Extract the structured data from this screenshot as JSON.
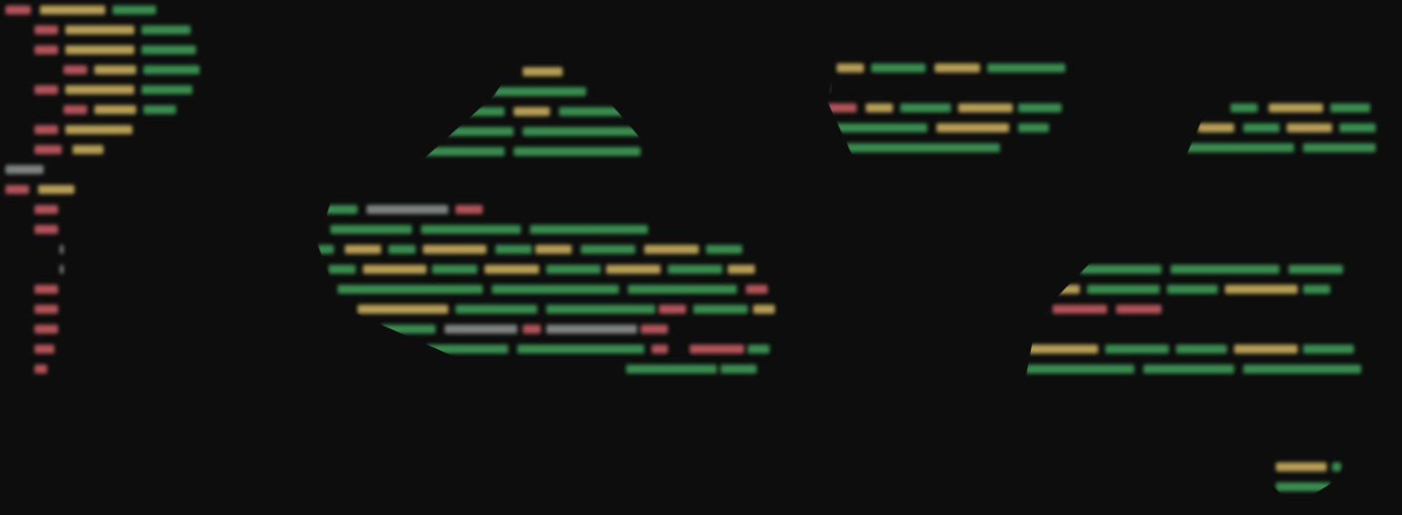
{
  "colors": {
    "background": "#0d0d0d",
    "tag": "#c25b61",
    "attribute": "#c9ae5e",
    "string": "#3f9a58",
    "plain": "#8a8f8c"
  },
  "fragments": [
    {
      "name": "code-fragment-left",
      "lines": [
        [
          [
            "tag",
            6,
            28
          ],
          [
            "attribute",
            44,
            72
          ],
          [
            "string",
            124,
            48
          ]
        ],
        [
          [
            "tag",
            38,
            26
          ],
          [
            "attribute",
            72,
            76
          ],
          [
            "string",
            156,
            54
          ]
        ],
        [
          [
            "tag",
            38,
            26
          ],
          [
            "attribute",
            72,
            76
          ],
          [
            "string",
            156,
            60
          ]
        ],
        [
          [
            "tag",
            70,
            26
          ],
          [
            "attribute",
            104,
            46
          ],
          [
            "string",
            158,
            62
          ]
        ],
        [
          [
            "tag",
            38,
            26
          ],
          [
            "attribute",
            72,
            76
          ],
          [
            "string",
            156,
            56
          ]
        ],
        [
          [
            "tag",
            70,
            26
          ],
          [
            "attribute",
            104,
            46
          ],
          [
            "string",
            158,
            36
          ]
        ],
        [
          [
            "tag",
            38,
            26
          ],
          [
            "attribute",
            72,
            74
          ]
        ],
        [
          [
            "tag",
            38,
            30
          ],
          [
            "attribute",
            80,
            34
          ]
        ],
        [
          [
            "plain",
            6,
            42
          ]
        ],
        [
          [
            "tag",
            6,
            26
          ],
          [
            "attribute",
            42,
            40
          ]
        ],
        [
          [
            "tag",
            38,
            26
          ]
        ],
        [
          [
            "tag",
            38,
            26
          ]
        ],
        [
          [
            "plain",
            66,
            4
          ]
        ],
        [
          [
            "plain",
            66,
            4
          ]
        ],
        [
          [
            "tag",
            38,
            26
          ]
        ],
        [
          [
            "tag",
            38,
            26
          ]
        ],
        [
          [
            "tag",
            38,
            26
          ]
        ],
        [
          [
            "tag",
            38,
            22
          ]
        ],
        [
          [
            "tag",
            38,
            14
          ]
        ]
      ]
    },
    {
      "name": "code-fragment-top-center",
      "lines": [
        [
          [
            "attribute",
            110,
            44
          ]
        ],
        [
          [
            "string",
            70,
            110
          ]
        ],
        [
          [
            "string",
            50,
            40
          ],
          [
            "attribute",
            100,
            40
          ],
          [
            "string",
            150,
            80
          ]
        ],
        [
          [
            "string",
            20,
            80
          ],
          [
            "string",
            110,
            130
          ]
        ],
        [
          [
            "string",
            0,
            90
          ],
          [
            "string",
            100,
            140
          ]
        ]
      ]
    },
    {
      "name": "code-fragment-top-right-center",
      "lines": [
        [
          [
            "attribute",
            10,
            30
          ],
          [
            "string",
            48,
            60
          ],
          [
            "attribute",
            118,
            50
          ],
          [
            "string",
            176,
            86
          ]
        ],
        [
          [
            "plain",
            0,
            2
          ]
        ],
        [
          [
            "tag",
            0,
            32
          ],
          [
            "attribute",
            42,
            30
          ],
          [
            "string",
            80,
            56
          ],
          [
            "attribute",
            144,
            60
          ],
          [
            "string",
            210,
            48
          ]
        ],
        [
          [
            "string",
            0,
            110
          ],
          [
            "attribute",
            120,
            80
          ],
          [
            "string",
            210,
            34
          ]
        ],
        [
          [
            "string",
            20,
            170
          ]
        ]
      ]
    },
    {
      "name": "code-fragment-top-right",
      "lines": [
        [
          [
            "string",
            50,
            30
          ],
          [
            "attribute",
            92,
            60
          ],
          [
            "string",
            160,
            44
          ]
        ],
        [
          [
            "attribute",
            14,
            40
          ],
          [
            "string",
            64,
            40
          ],
          [
            "attribute",
            112,
            50
          ],
          [
            "string",
            170,
            40
          ]
        ],
        [
          [
            "string",
            0,
            120
          ],
          [
            "string",
            130,
            80
          ]
        ]
      ]
    },
    {
      "name": "code-fragment-center",
      "lines": [
        [
          [
            "string",
            4,
            40
          ],
          [
            "plain",
            54,
            90
          ],
          [
            "tag",
            152,
            30
          ]
        ],
        [
          [
            "string",
            14,
            90
          ],
          [
            "string",
            114,
            110
          ],
          [
            "string",
            234,
            130
          ]
        ],
        [
          [
            "string",
            0,
            18
          ],
          [
            "attribute",
            30,
            40
          ],
          [
            "string",
            78,
            30
          ],
          [
            "attribute",
            116,
            70
          ],
          [
            "string",
            196,
            40
          ],
          [
            "attribute",
            240,
            40
          ],
          [
            "string",
            290,
            60
          ],
          [
            "attribute",
            360,
            60
          ],
          [
            "string",
            428,
            40
          ]
        ],
        [
          [
            "string",
            12,
            30
          ],
          [
            "attribute",
            50,
            70
          ],
          [
            "string",
            126,
            50
          ],
          [
            "attribute",
            184,
            60
          ],
          [
            "string",
            252,
            60
          ],
          [
            "attribute",
            318,
            60
          ],
          [
            "string",
            386,
            60
          ],
          [
            "attribute",
            452,
            30
          ]
        ],
        [
          [
            "string",
            22,
            160
          ],
          [
            "string",
            192,
            140
          ],
          [
            "string",
            342,
            120
          ],
          [
            "tag",
            472,
            24
          ]
        ],
        [
          [
            "attribute",
            44,
            100
          ],
          [
            "string",
            152,
            90
          ],
          [
            "string",
            252,
            120
          ],
          [
            "tag",
            376,
            30
          ],
          [
            "string",
            414,
            60
          ],
          [
            "attribute",
            480,
            24
          ]
        ],
        [
          [
            "string",
            70,
            60
          ],
          [
            "plain",
            140,
            80
          ],
          [
            "tag",
            226,
            20
          ],
          [
            "plain",
            252,
            100
          ],
          [
            "tag",
            356,
            30
          ]
        ],
        [
          [
            "string",
            120,
            90
          ],
          [
            "string",
            220,
            140
          ],
          [
            "tag",
            368,
            18
          ],
          [
            "tag",
            410,
            60
          ],
          [
            "string",
            474,
            24
          ]
        ],
        [
          [
            "string",
            340,
            100
          ],
          [
            "string",
            444,
            40
          ]
        ]
      ]
    },
    {
      "name": "code-fragment-right",
      "lines": [
        [
          [
            "string",
            60,
            90
          ],
          [
            "string",
            160,
            120
          ],
          [
            "string",
            290,
            60
          ]
        ],
        [
          [
            "attribute",
            20,
            40
          ],
          [
            "string",
            68,
            80
          ],
          [
            "string",
            156,
            56
          ],
          [
            "attribute",
            220,
            80
          ],
          [
            "string",
            306,
            30
          ]
        ],
        [
          [
            "string",
            0,
            22
          ],
          [
            "tag",
            30,
            60
          ],
          [
            "tag",
            100,
            50
          ]
        ],
        [
          [
            "plain",
            0,
            2
          ]
        ],
        [
          [
            "attribute",
            0,
            80
          ],
          [
            "string",
            88,
            70
          ],
          [
            "string",
            166,
            56
          ],
          [
            "attribute",
            230,
            70
          ],
          [
            "string",
            306,
            56
          ]
        ],
        [
          [
            "string",
            0,
            120
          ],
          [
            "string",
            130,
            100
          ],
          [
            "string",
            240,
            130
          ]
        ]
      ]
    },
    {
      "name": "code-fragment-bottom-right",
      "lines": [
        [
          [
            "attribute",
            30,
            56
          ],
          [
            "string",
            92,
            10
          ]
        ],
        [
          [
            "string",
            30,
            60
          ]
        ]
      ]
    }
  ]
}
